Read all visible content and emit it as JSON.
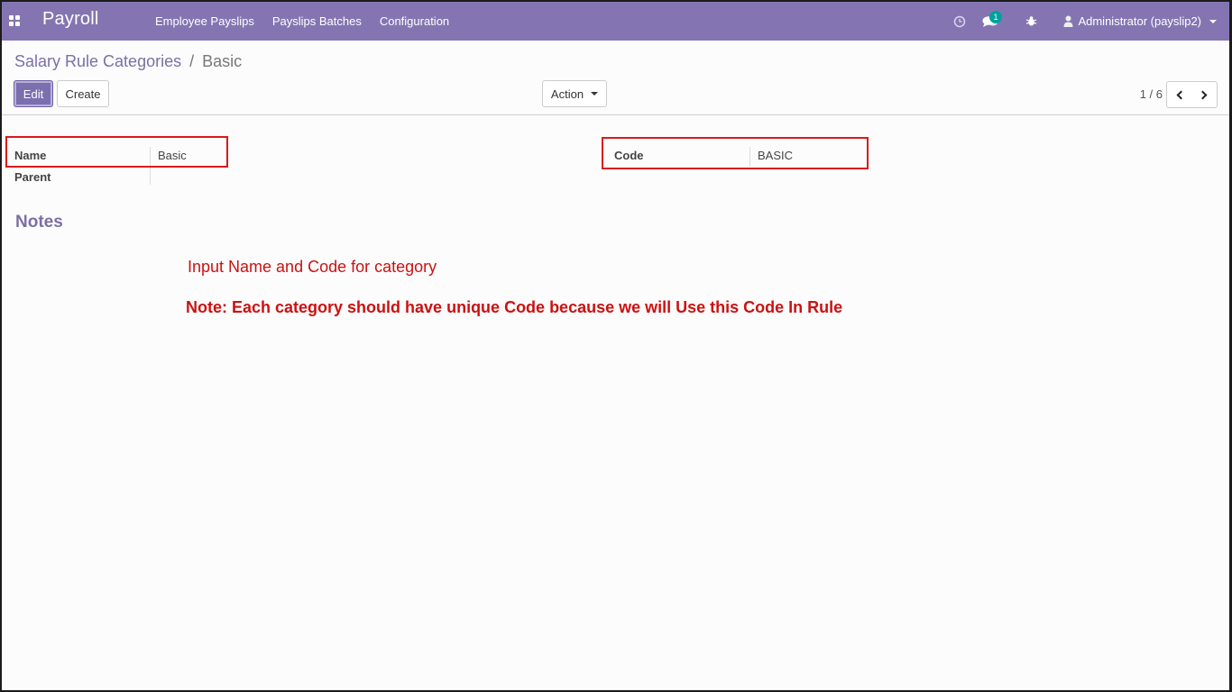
{
  "navbar": {
    "app_name": "Payroll",
    "menu": [
      {
        "label": "Employee Payslips"
      },
      {
        "label": "Payslips Batches"
      },
      {
        "label": "Configuration"
      }
    ],
    "messages_badge": "1",
    "user_label": "Administrator (payslip2)",
    "color": "#8475b2"
  },
  "breadcrumb": {
    "parent": "Salary Rule Categories",
    "separator": "/",
    "current": "Basic"
  },
  "buttons": {
    "edit": "Edit",
    "create": "Create",
    "action": "Action"
  },
  "pager": {
    "value": "1 / 6"
  },
  "form": {
    "name_label": "Name",
    "name_value": "Basic",
    "parent_label": "Parent",
    "parent_value": "",
    "code_label": "Code",
    "code_value": "BASIC",
    "notes_title": "Notes"
  },
  "annotations": {
    "line1": "Input Name and Code for category",
    "line2": "Note: Each category should have unique Code because we will Use this Code In Rule",
    "color": "#cc1111"
  },
  "icons": {
    "apps": "apps-grid-icon",
    "activity": "clock-icon",
    "messages": "chat-icon",
    "debug": "bug-icon",
    "user": "user-icon",
    "pager_prev": "chevron-left-icon",
    "pager_next": "chevron-right-icon"
  }
}
